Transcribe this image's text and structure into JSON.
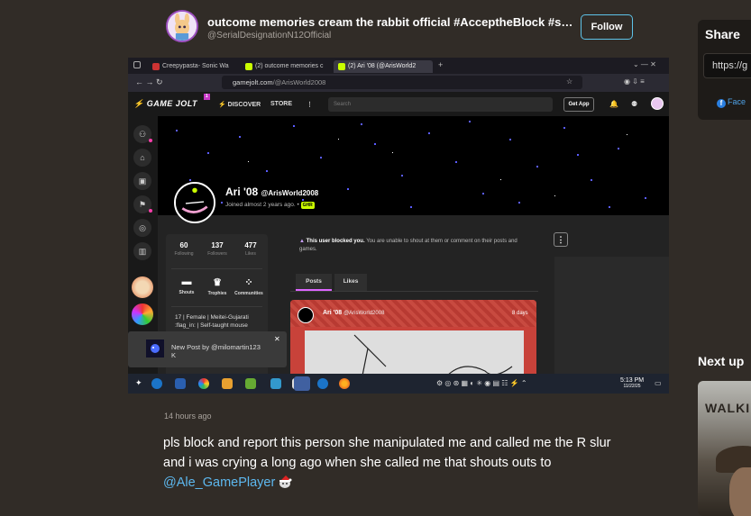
{
  "author": {
    "name": "outcome memories cream the rabbit official #AcceptheBlock #suppor…",
    "handle": "@SerialDesignationN12Official",
    "follow_label": "Follow"
  },
  "share": {
    "title": "Share",
    "url": "https://g",
    "facebook_label": "Face"
  },
  "next_up": {
    "title": "Next up",
    "thumb_text": "WALKIN"
  },
  "screenshot": {
    "tabs": [
      {
        "label": "Creepypasta- Sonic Wa"
      },
      {
        "label": "(2) outcome memories c"
      },
      {
        "label": "(2) Ari '08 (@ArisWorld2"
      }
    ],
    "url_domain": "gamejolt.com",
    "url_path": "/@ArisWorld2008",
    "nav": {
      "logo": "GAME JOLT",
      "logo_badge": "1",
      "discover": "DISCOVER",
      "store": "STORE",
      "search_placeholder": "Search",
      "get_app": "Get App"
    },
    "profile": {
      "name": "Ari '08",
      "handle": "@ArisWorld2008",
      "joined": "Joined almost 2 years ago.",
      "chip": "GHR",
      "stats": [
        {
          "value": "60",
          "label": "Following"
        },
        {
          "value": "137",
          "label": "Followers"
        },
        {
          "value": "477",
          "label": "Likes"
        }
      ],
      "actions": [
        {
          "label": "Shouts"
        },
        {
          "label": "Trophies"
        },
        {
          "label": "Communities"
        }
      ],
      "bio": "17 | Female | Meitei-Gujarati :flag_in: | Self-taught mouse"
    },
    "blocked_bold": "This user blocked you.",
    "blocked_text": "You are unable to shout at them or comment on their posts and games.",
    "post_tabs": [
      "Posts",
      "Likes"
    ],
    "post": {
      "name": "Ari '08",
      "handle": "@ArisWorld2008",
      "age": "8 days"
    },
    "notification": {
      "text": "New Post by @milomartin123",
      "sub": "K"
    },
    "taskbar": {
      "time": "5:13 PM",
      "date": "11/22/25"
    }
  },
  "post": {
    "timestamp": "14 hours ago",
    "caption": "pls block and report this person she manipulated me and called me the R slur and i was crying a long ago when she called me that shouts outs to ",
    "mention": "@Ale_GamePlayer"
  }
}
